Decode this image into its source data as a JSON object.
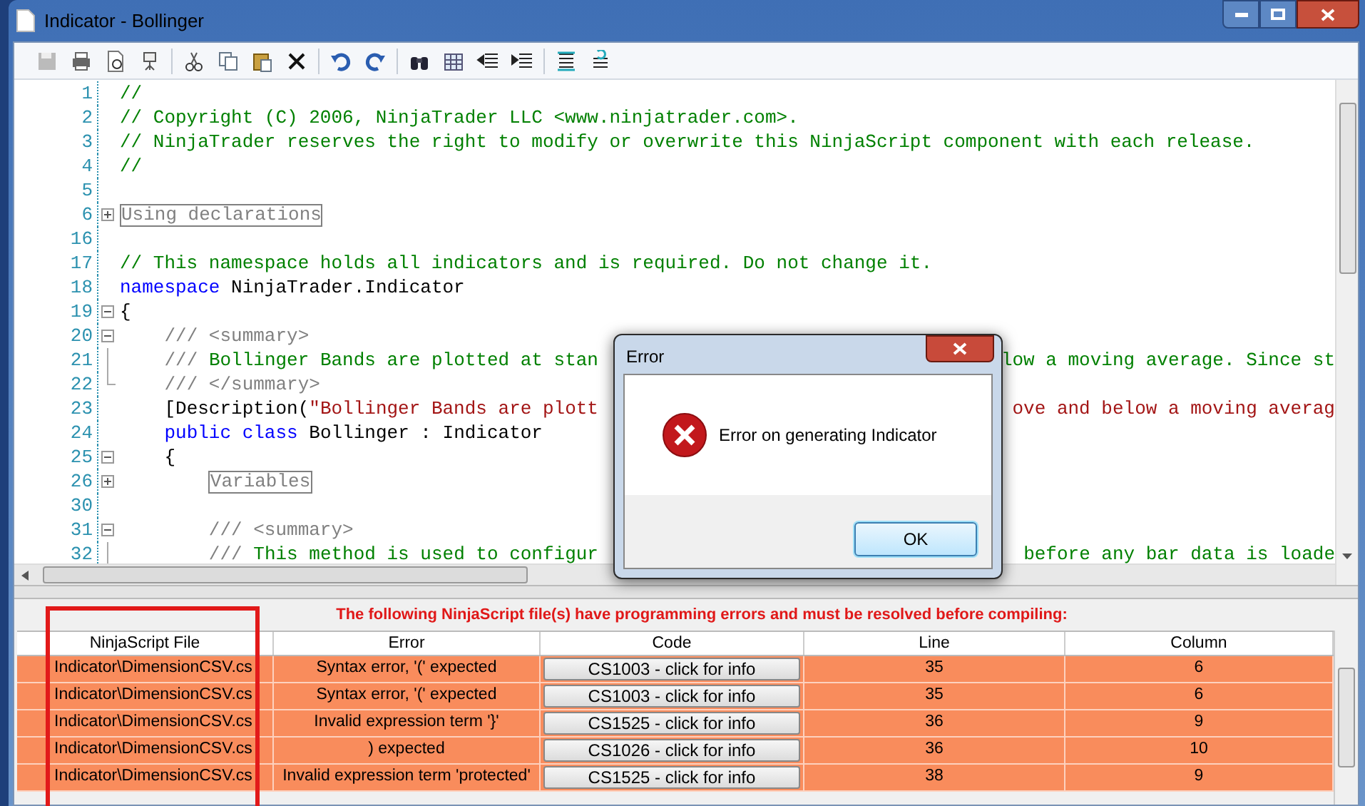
{
  "window": {
    "title": "Indicator - Bollinger"
  },
  "editor": {
    "lines": [
      {
        "number": "1",
        "segments": [
          {
            "text": "//",
            "kind": "comment"
          }
        ]
      },
      {
        "number": "2",
        "segments": [
          {
            "text": "// Copyright (C) 2006, NinjaTrader LLC <www.ninjatrader.com>.",
            "kind": "comment"
          }
        ]
      },
      {
        "number": "3",
        "segments": [
          {
            "text": "// NinjaTrader reserves the right to modify or overwrite this NinjaScript component with each release.",
            "kind": "comment"
          }
        ]
      },
      {
        "number": "4",
        "segments": [
          {
            "text": "//",
            "kind": "comment"
          }
        ]
      },
      {
        "number": "5"
      },
      {
        "number": "6",
        "kind": "expand",
        "segments": [
          {
            "text": "Using declarations",
            "kind": "region"
          }
        ]
      },
      {
        "number": "16"
      },
      {
        "number": "17",
        "segments": [
          {
            "text": "// This namespace holds all indicators and is required. Do not change it.",
            "kind": "comment"
          }
        ]
      },
      {
        "number": "18",
        "segments": [
          {
            "text": "namespace",
            "kind": "keyword"
          },
          {
            "text": " NinjaTrader.Indicator",
            "kind": "plain"
          }
        ]
      },
      {
        "number": "19",
        "kind": "collapse",
        "segments": [
          {
            "text": "{",
            "kind": "plain"
          }
        ]
      },
      {
        "number": "20",
        "kind": "collapse",
        "segments": [
          {
            "text": "    /// <summary>",
            "kind": "doc"
          }
        ]
      },
      {
        "number": "21",
        "kind": "fold-line",
        "segments": [
          {
            "text": "    ///",
            "kind": "doc"
          },
          {
            "text": " Bollinger Bands are plotted at stan",
            "kind": "comment"
          }
        ],
        "tail": [
          {
            "text": "low a moving average. Since st",
            "kind": "comment"
          }
        ]
      },
      {
        "number": "22",
        "kind": "fold-end",
        "segments": [
          {
            "text": "    /// </summary>",
            "kind": "doc"
          }
        ]
      },
      {
        "number": "23",
        "segments": [
          {
            "text": "    [Description(",
            "kind": "plain"
          },
          {
            "text": "\"Bollinger Bands are plott",
            "kind": "string"
          }
        ],
        "tail": [
          {
            "text": "ove and below a moving averag",
            "kind": "string"
          }
        ]
      },
      {
        "number": "24",
        "segments": [
          {
            "text": "    public class",
            "kind": "keyword"
          },
          {
            "text": " Bollinger : Indicator",
            "kind": "plain"
          }
        ]
      },
      {
        "number": "25",
        "kind": "collapse",
        "segments": [
          {
            "text": "    {",
            "kind": "plain"
          }
        ]
      },
      {
        "number": "26",
        "kind": "expand",
        "segments": [
          {
            "text": "        Variables",
            "kind": "region"
          }
        ]
      },
      {
        "number": "30"
      },
      {
        "number": "31",
        "kind": "collapse",
        "segments": [
          {
            "text": "        /// <summary>",
            "kind": "doc"
          }
        ]
      },
      {
        "number": "32",
        "kind": "fold-line",
        "segments": [
          {
            "text": "        ///",
            "kind": "doc"
          },
          {
            "text": " This method is used to configur",
            "kind": "comment"
          }
        ],
        "tail": [
          {
            "text": "before any bar data is loade",
            "kind": "comment"
          }
        ]
      }
    ]
  },
  "errors": {
    "message": "The following NinjaScript file(s) have programming errors and must be resolved before compiling:",
    "columns": [
      "NinjaScript File",
      "Error",
      "Code",
      "Line",
      "Column"
    ],
    "rows": [
      {
        "file": "Indicator\\DimensionCSV.cs",
        "error": "Syntax error, '(' expected",
        "code": "CS1003 - click for info",
        "line": "35",
        "column": "6"
      },
      {
        "file": "Indicator\\DimensionCSV.cs",
        "error": "Syntax error, '(' expected",
        "code": "CS1003 - click for info",
        "line": "35",
        "column": "6"
      },
      {
        "file": "Indicator\\DimensionCSV.cs",
        "error": "Invalid expression term '}'",
        "code": "CS1525 - click for info",
        "line": "36",
        "column": "9"
      },
      {
        "file": "Indicator\\DimensionCSV.cs",
        "error": ") expected",
        "code": "CS1026 - click for info",
        "line": "36",
        "column": "10"
      },
      {
        "file": "Indicator\\DimensionCSV.cs",
        "error": "Invalid expression term 'protected'",
        "code": "CS1525 - click for info",
        "line": "38",
        "column": "9"
      }
    ]
  },
  "dialog": {
    "title": "Error",
    "message": "Error on generating Indicator",
    "button": "OK"
  }
}
